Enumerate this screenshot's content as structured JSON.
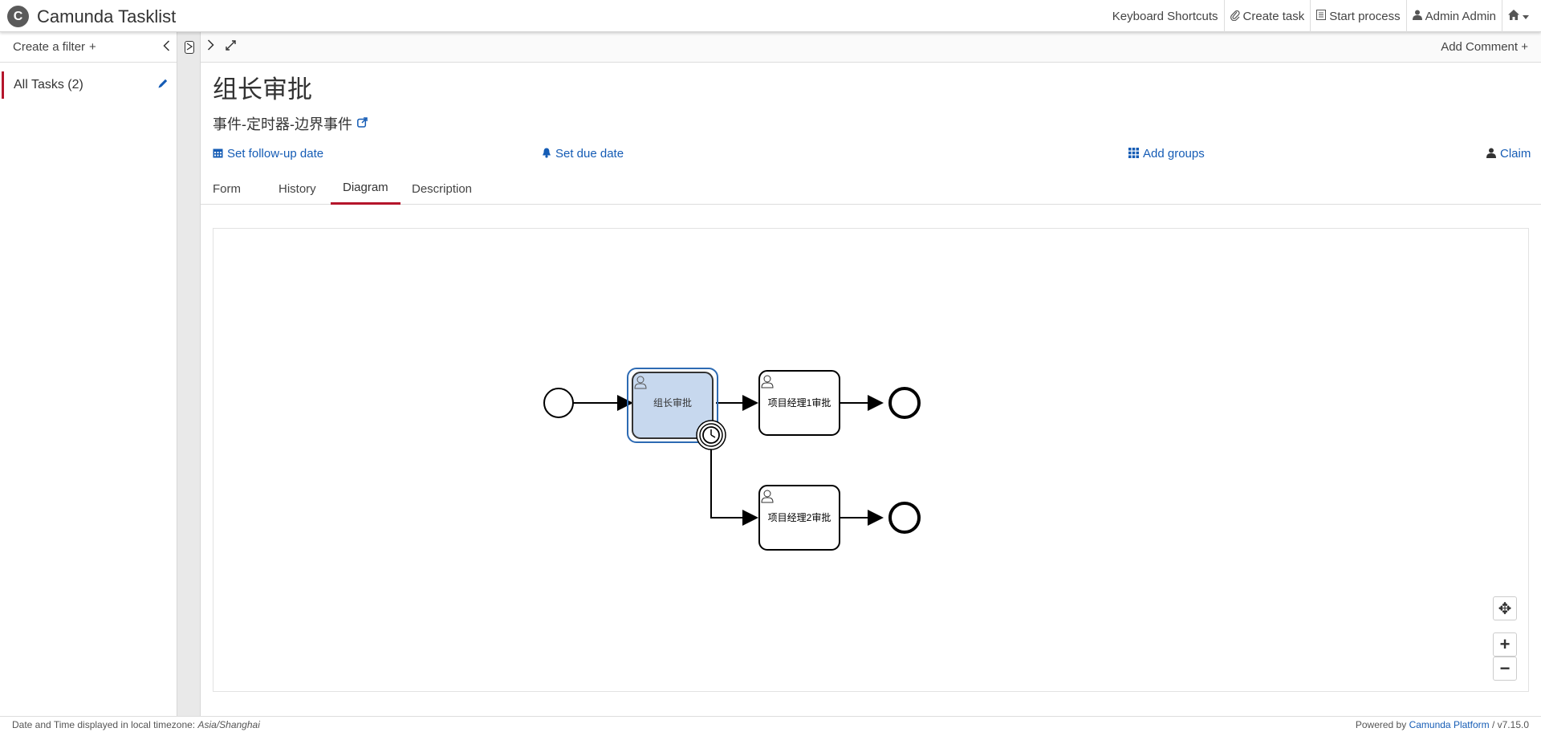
{
  "header": {
    "brand_icon": "C",
    "app_title": "Camunda Tasklist",
    "nav": {
      "shortcuts": "Keyboard Shortcuts",
      "create_task": "Create task",
      "start_process": "Start process",
      "user": "Admin Admin"
    }
  },
  "sidebar": {
    "create_filter": "Create a filter",
    "plus": "+",
    "collapse": "‹",
    "filters": [
      {
        "label": "All Tasks (2)"
      }
    ]
  },
  "toolbar": {
    "expand": "›",
    "fullscreen": "⤢",
    "add_comment": "Add Comment"
  },
  "task": {
    "title": "组长审批",
    "process_name": "事件-定时器-边界事件",
    "actions": {
      "follow_up": "Set follow-up date",
      "due": "Set due date",
      "groups": "Add groups",
      "claim": "Claim"
    },
    "tabs": [
      "Form",
      "History",
      "Diagram",
      "Description"
    ],
    "active_tab": "Diagram"
  },
  "diagram": {
    "tasks": {
      "leader": "组长审批",
      "pm1": "项目经理1审批",
      "pm2": "项目经理2审批"
    },
    "highlight_color": "#c7d8ee",
    "highlight_border": "#2d6ab3",
    "zoom_reset": "✥",
    "zoom_in": "+",
    "zoom_out": "−"
  },
  "footer": {
    "timezone_text": "Date and Time displayed in local timezone:",
    "timezone": "Asia/Shanghai",
    "powered_by": "Powered by",
    "platform": "Camunda Platform",
    "version": "/ v7.15.0"
  },
  "colors": {
    "accent_red": "#b5152b",
    "link_blue": "#155cb5"
  }
}
